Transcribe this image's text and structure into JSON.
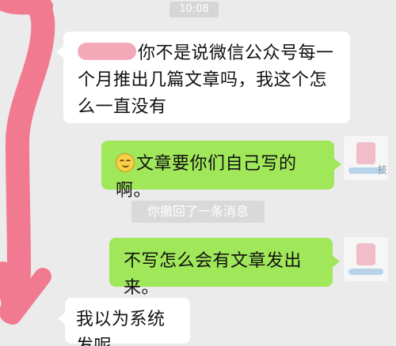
{
  "chat": {
    "timestamp": "10:08",
    "messages": [
      {
        "sender": "other",
        "text": "你不是说微信公众号每一个月推出几篇文章吗，我这个怎么一直没有"
      },
      {
        "sender": "self",
        "emoji": "smiling-face-emoji",
        "text": "文章要你们自己写的啊。"
      },
      {
        "sender": "self",
        "text": "不写怎么会有文章发出来。"
      },
      {
        "sender": "other",
        "text": "我以为系统发呢"
      }
    ],
    "system_notice": "你撤回了一条消息",
    "avatar_char": "技"
  },
  "colors": {
    "background": "#ebebeb",
    "incoming_bubble": "#ffffff",
    "outgoing_bubble": "#a0e75a",
    "redaction_scribble": "#f27a90"
  }
}
